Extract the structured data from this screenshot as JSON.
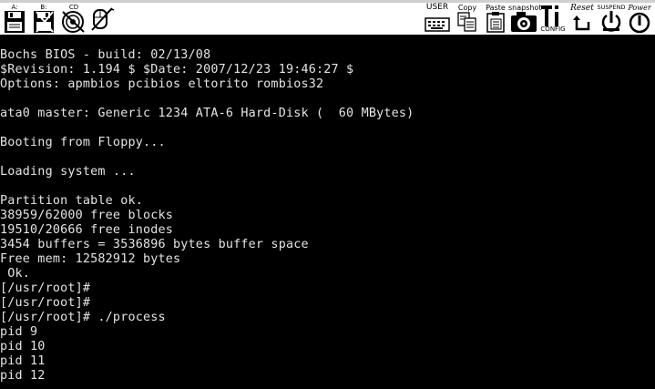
{
  "toolbar": {
    "left": {
      "floppy_a_label": "A:",
      "floppy_b_label": "B:",
      "cdrom_label": "CD"
    },
    "right": {
      "user_label": "USER",
      "copy_label": "Copy",
      "paste_label": "Paste",
      "snapshot_label": "snapshot",
      "config_label": "CONFIG",
      "reset_label": "Reset",
      "suspend_label": "SUSPEND",
      "power_label": "Power"
    },
    "icons": [
      "floppy-a-icon",
      "floppy-b-icon",
      "cdrom-icon",
      "mouse-icon",
      "user-icon",
      "copy-icon",
      "paste-icon",
      "snapshot-icon",
      "config-icon",
      "reset-icon",
      "suspend-icon",
      "power-icon"
    ]
  },
  "console": {
    "lines": [
      "Bochs BIOS - build: 02/13/08",
      "$Revision: 1.194 $ $Date: 2007/12/23 19:46:27 $",
      "Options: apmbios pcibios eltorito rombios32",
      "",
      "ata0 master: Generic 1234 ATA-6 Hard-Disk (  60 MBytes)",
      "",
      "Booting from Floppy...",
      "",
      "Loading system ...",
      "",
      "Partition table ok.",
      "38959/62000 free blocks",
      "19510/20666 free inodes",
      "3454 buffers = 3536896 bytes buffer space",
      "Free mem: 12582912 bytes",
      " Ok.",
      "[/usr/root]#",
      "[/usr/root]#",
      "[/usr/root]# ./process",
      "pid 9",
      "pid 10",
      "pid 11",
      "pid 12"
    ]
  },
  "colors": {
    "screen_bg": "#000000",
    "text": "#e4e4e4",
    "toolbar_bg": "#ffffff"
  }
}
